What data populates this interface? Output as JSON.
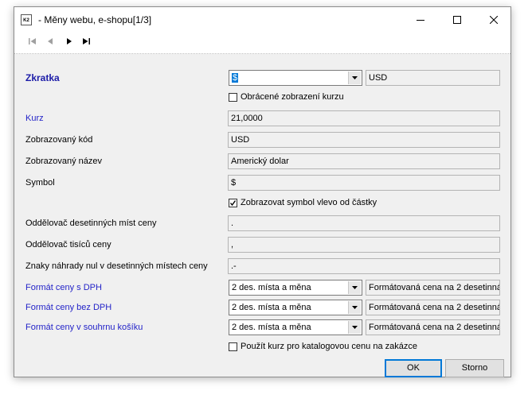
{
  "window": {
    "title": "- Měny webu, e-shopu[1/3]",
    "icon_label": "K2",
    "icon_name": "app-k2-icon"
  },
  "toolbar": {
    "icons": [
      "first-record-icon",
      "previous-record-icon",
      "next-record-icon",
      "last-record-icon"
    ]
  },
  "form": {
    "zkratka": {
      "label": "Zkratka",
      "selected": "$",
      "code": "USD"
    },
    "inverted_rate": {
      "label": "Obrácené zobrazení kurzu",
      "checked": false
    },
    "kurz": {
      "label": "Kurz",
      "value": "21,0000"
    },
    "display_code": {
      "label": "Zobrazovaný kód",
      "value": "USD"
    },
    "display_name": {
      "label": "Zobrazovaný název",
      "value": "Americký dolar"
    },
    "symbol": {
      "label": "Symbol",
      "value": "$"
    },
    "symbol_left": {
      "label": "Zobrazovat symbol vlevo od částky",
      "checked": true
    },
    "decimal_separator": {
      "label": "Oddělovač desetinných míst ceny",
      "value": "."
    },
    "thousands_separator": {
      "label": "Oddělovač tisíců ceny",
      "value": ","
    },
    "zero_replacement": {
      "label": "Znaky náhrady nul v desetinných místech ceny",
      "value": ".-"
    },
    "price_with_vat": {
      "label": "Formát ceny s DPH",
      "selected": "2 des. místa a měna",
      "preview": "Formátovaná cena na 2 desetinná"
    },
    "price_without_vat": {
      "label": "Formát ceny bez DPH",
      "selected": "2 des. místa a měna",
      "preview": "Formátovaná cena na 2 desetinná"
    },
    "price_cart": {
      "label": "Formát ceny v souhrnu košíku",
      "selected": "2 des. místa a měna",
      "preview": "Formátovaná cena na 2 desetinná"
    },
    "catalog_rate": {
      "label": "Použít kurz pro katalogovou cenu na zakázce",
      "checked": false
    }
  },
  "buttons": {
    "ok": "OK",
    "cancel": "Storno"
  },
  "colors": {
    "accent": "#0078d7",
    "label_blue": "#2323c8",
    "background": "#f0f0f0"
  }
}
